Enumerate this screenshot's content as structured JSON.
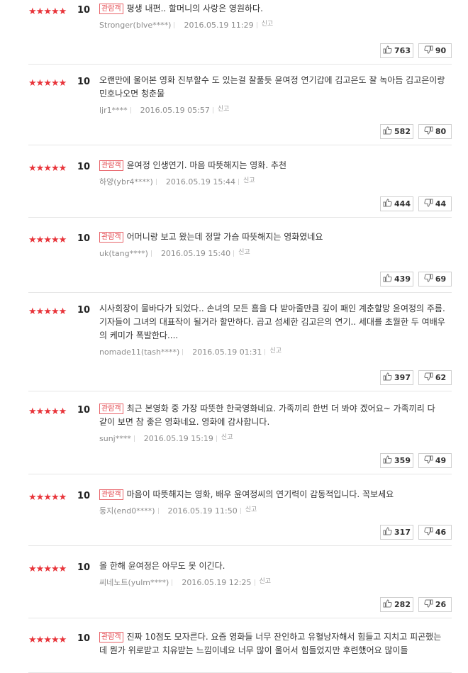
{
  "icons": {
    "star": "star-icon",
    "like": "thumbs-up-icon",
    "dislike": "thumbs-down-icon"
  },
  "colors": {
    "star": "#e8343a",
    "badge": "#e34a50"
  },
  "reviews": [
    {
      "stars": 5,
      "score": "10",
      "badge": "관람객",
      "text": "평생 내편.. 할머니의 사랑은 영원하다.",
      "author": "Stronger(blve****)",
      "date": "2016.05.19 11:29",
      "report": "신고",
      "likes": "763",
      "dislikes": "90"
    },
    {
      "stars": 5,
      "score": "10",
      "badge": "",
      "text": "오랜만에 울어본 영화 진부할수 도 있는걸 잘풀듯 윤여정 연기갑에 김고은도 잘 녹아듬 김고은이랑민호나오면 청춘물",
      "author": "ljr1****",
      "date": "2016.05.19 05:57",
      "report": "신고",
      "likes": "582",
      "dislikes": "80"
    },
    {
      "stars": 5,
      "score": "10",
      "badge": "관람객",
      "text": "윤여정 인생연기. 마음 따뜻해지는 영화. 추천",
      "author": "하양(ybr4****)",
      "date": "2016.05.19 15:44",
      "report": "신고",
      "likes": "444",
      "dislikes": "44"
    },
    {
      "stars": 5,
      "score": "10",
      "badge": "관람객",
      "text": "어머니랑 보고 왔는데 정말 가슴 따뜻해지는 영화였네요",
      "author": "uk(tang****)",
      "date": "2016.05.19 15:40",
      "report": "신고",
      "likes": "439",
      "dislikes": "69"
    },
    {
      "stars": 5,
      "score": "10",
      "badge": "",
      "text": "시사회장이 물바다가 되었다.. 손녀의 모든 흠을 다 받아줄만큼 깊이 패인 계춘할망 윤여정의 주름. 기자들이 그녀의 대표작이 될거라 할만하다. 곱고 섬세한 김고은의 연기.. 세대를 초월한 두 여배우의 케미가 폭발한다....",
      "author": "nomade11(tash****)",
      "date": "2016.05.19 01:31",
      "report": "신고",
      "likes": "397",
      "dislikes": "62"
    },
    {
      "stars": 5,
      "score": "10",
      "badge": "관람객",
      "text": "최근 본영화 중 가장 따뜻한 한국영화네요. 가족끼리 한번 더 봐야 겠어요~ 가족끼리 다 같이 보면 참 좋은 영화네요. 영화에 감사합니다.",
      "author": "sunj****",
      "date": "2016.05.19 15:19",
      "report": "신고",
      "likes": "359",
      "dislikes": "49"
    },
    {
      "stars": 5,
      "score": "10",
      "badge": "관람객",
      "text": "마음이 따뜻해지는 영화, 배우 윤여정씨의 연기력이 감동적입니다. 꼭보세요",
      "author": "둥지(end0****)",
      "date": "2016.05.19 11:50",
      "report": "신고",
      "likes": "317",
      "dislikes": "46"
    },
    {
      "stars": 5,
      "score": "10",
      "badge": "",
      "text": "올 한해 윤여정은 아무도 못 이긴다.",
      "author": "씨네노트(yulm****)",
      "date": "2016.05.19 12:25",
      "report": "신고",
      "likes": "282",
      "dislikes": "26"
    },
    {
      "stars": 5,
      "score": "10",
      "badge": "관람객",
      "text": "진짜 10점도 모자른다. 요즘 영화들 너무 잔인하고 유혈낭자해서 힘들고 지치고 피곤했는데 뭔가 위로받고 치유받는 느낌이네요 너무 많이 울어서 힘들었지만 후련했어요 많이들",
      "author": "",
      "date": "",
      "report": "",
      "likes": "",
      "dislikes": ""
    }
  ]
}
